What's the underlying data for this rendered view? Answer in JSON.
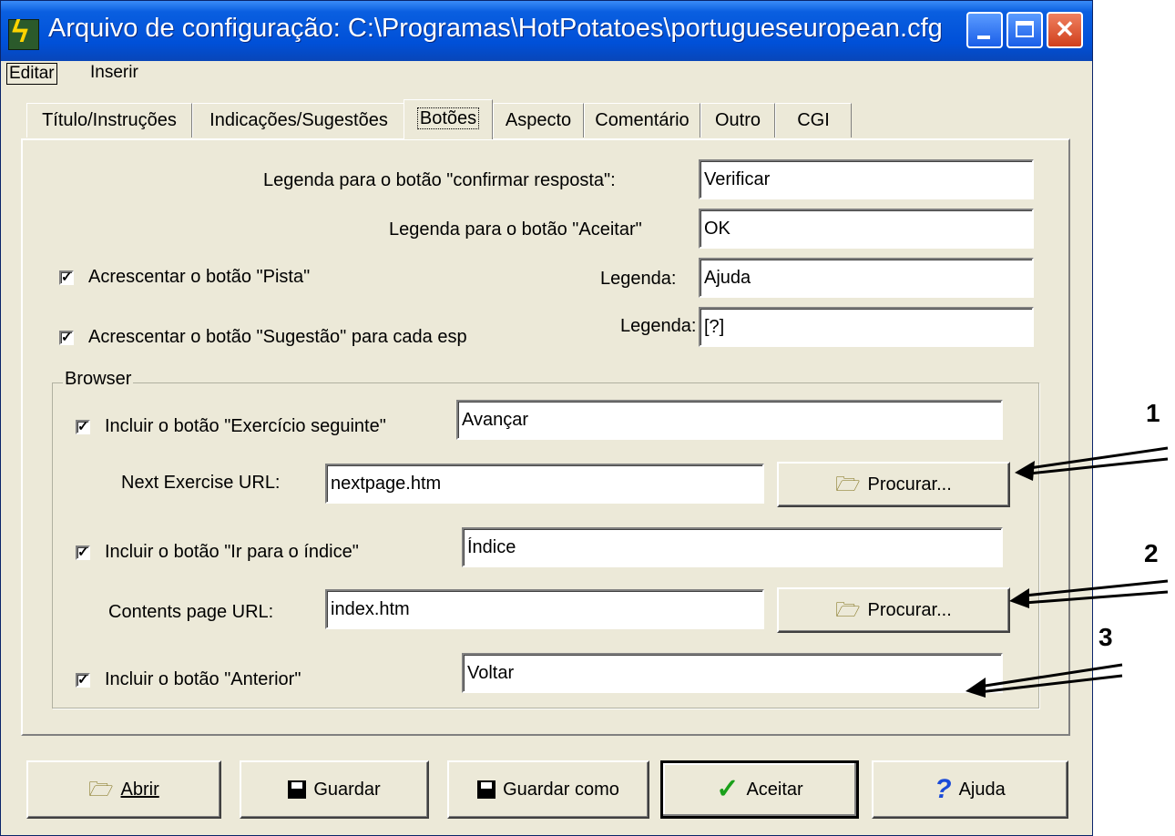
{
  "window": {
    "title": "Arquivo de configuração: C:\\Programas\\HotPotatoes\\portugueseuropean.cfg"
  },
  "menu": {
    "edit": "Editar",
    "insert": "Inserir"
  },
  "tabs": [
    {
      "label": "Título/Instruções"
    },
    {
      "label": "Indicações/Sugestões"
    },
    {
      "label": "Botões",
      "active": true
    },
    {
      "label": "Aspecto"
    },
    {
      "label": "Comentário"
    },
    {
      "label": "Outro"
    },
    {
      "label": "CGI"
    }
  ],
  "buttons_tab": {
    "check_caption_label": "Legenda para o botão \"confirmar resposta\":",
    "check_caption_value": "Verificar",
    "ok_caption_label": "Legenda para o botão \"Aceitar\"",
    "ok_caption_value": "OK",
    "hint": {
      "label": "Acrescentar o botão \"Pista\"",
      "checked": true,
      "caption_label": "Legenda:",
      "caption_value": "Ajuda"
    },
    "clue": {
      "label": "Acrescentar o botão \"Sugestão\" para cada esp",
      "checked": true,
      "caption_label": "Legenda:",
      "caption_value": "[?]"
    },
    "browser": {
      "legend": "Browser",
      "next": {
        "label": "Incluir o botão \"Exercício seguinte\"",
        "checked": true,
        "caption_value": "Avançar",
        "url_label": "Next Exercise URL:",
        "url_value": "nextpage.htm",
        "browse_label": "Procurar..."
      },
      "index": {
        "label": "Incluir o botão  \"Ir para o índice\"",
        "checked": true,
        "caption_value": "Índice",
        "url_label": "Contents page URL:",
        "url_value": "index.htm",
        "browse_label": "Procurar..."
      },
      "back": {
        "label": "Incluir o botão \"Anterior\"",
        "checked": true,
        "caption_value": "Voltar"
      }
    }
  },
  "footer": {
    "open": "Abrir",
    "save": "Guardar",
    "save_as": "Guardar como",
    "ok": "Aceitar",
    "help": "Ajuda"
  },
  "annotations": [
    "1",
    "2",
    "3"
  ]
}
